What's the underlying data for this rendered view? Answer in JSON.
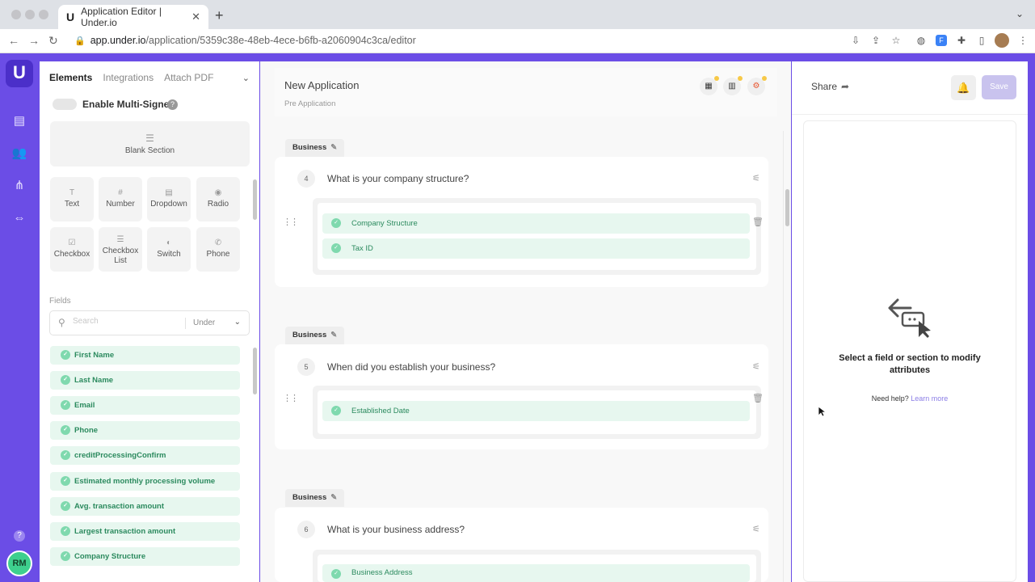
{
  "browser": {
    "tab_title": "Application Editor | Under.io",
    "tab_favicon": "U",
    "url_host": "app.under.io",
    "url_path": "/application/5359c38e-48eb-4ece-b6fb-a2060904c3ca/editor"
  },
  "rail": {
    "logo": "U",
    "user_initials": "RM",
    "help": "?"
  },
  "left_panel": {
    "tabs": [
      "Elements",
      "Integrations",
      "Attach PDF"
    ],
    "multi_signer_label": "Enable Multi-Signer",
    "help": "?",
    "blank_section": "Blank Section",
    "elements": [
      {
        "label": "Text",
        "icon": "T"
      },
      {
        "label": "Number",
        "icon": "#"
      },
      {
        "label": "Dropdown",
        "icon": "▤"
      },
      {
        "label": "Radio",
        "icon": "◉"
      },
      {
        "label": "Checkbox",
        "icon": "☑"
      },
      {
        "label": "Checkbox List",
        "icon": "☰"
      },
      {
        "label": "Switch",
        "icon": "◐"
      },
      {
        "label": "Phone",
        "icon": "✆"
      }
    ],
    "fields_label": "Fields",
    "search_placeholder": "Search",
    "search_filter": "Under",
    "fields": [
      "First Name",
      "Last Name",
      "Email",
      "Phone",
      "creditProcessingConfirm",
      "Estimated monthly processing volume",
      "Avg. transaction amount",
      "Largest transaction amount",
      "Company Structure"
    ]
  },
  "center": {
    "app_title": "New Application",
    "app_subtitle": "Pre Application",
    "questions": [
      {
        "section": "Business",
        "number": "4",
        "text": "What is your company structure?",
        "fields": [
          "Company Structure",
          "Tax ID"
        ]
      },
      {
        "section": "Business",
        "number": "5",
        "text": "When did you establish your business?",
        "fields": [
          "Established Date"
        ]
      },
      {
        "section": "Business",
        "number": "6",
        "text": "What is your business address?",
        "fields": [
          "Business Address"
        ]
      }
    ]
  },
  "right_panel": {
    "share_label": "Share",
    "save_label": "Save",
    "empty_title": "Select a field or section to modify attributes",
    "need_help": "Need help?",
    "learn_more": "Learn more"
  },
  "colors": {
    "brand": "#6b4de6",
    "field_bg": "#e7f7ef",
    "field_text": "#2b8a5e",
    "save_disabled": "#c9c3ee"
  }
}
